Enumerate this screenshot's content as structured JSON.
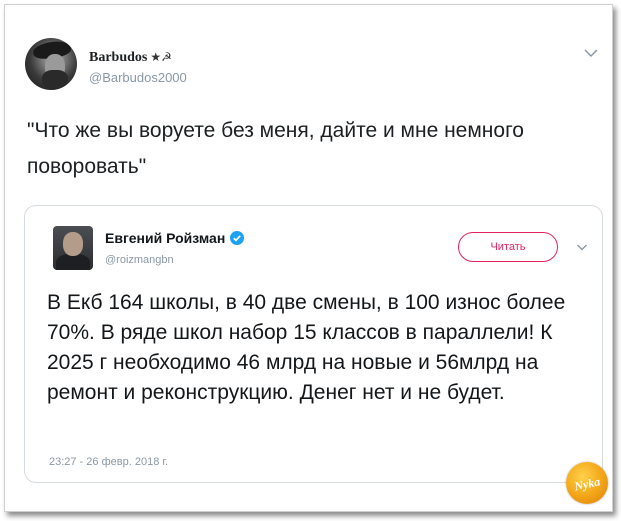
{
  "outer_tweet": {
    "author_name": "Barbudos",
    "author_emoji": "★☭",
    "handle": "@Barbudos2000",
    "text": "\"Что же вы воруете без меня, дайте и мне немного поворовать\""
  },
  "quoted_tweet": {
    "author_name": "Евгений Ройзман",
    "handle": "@roizmangbn",
    "read_button_label": "Читать",
    "text": "В Екб 164 школы, в 40 две смены, в 100 износ более 70%. В ряде  школ набор 15 классов в параллели! К 2025 г необходимо 46 млрд на новые и 56млрд на ремонт и реконструкцию. Денег нет и не будет.",
    "timestamp": "23:27 - 26 февр. 2018 г."
  },
  "watermark": {
    "text": "Nyka"
  },
  "colors": {
    "read_button": "#e0245e",
    "verified": "#1da1f2",
    "secondary_text": "#8a98a6",
    "watermark": "#f2a316"
  },
  "icons": {
    "verified": "verified-badge-icon",
    "chevron": "chevron-down-icon"
  }
}
